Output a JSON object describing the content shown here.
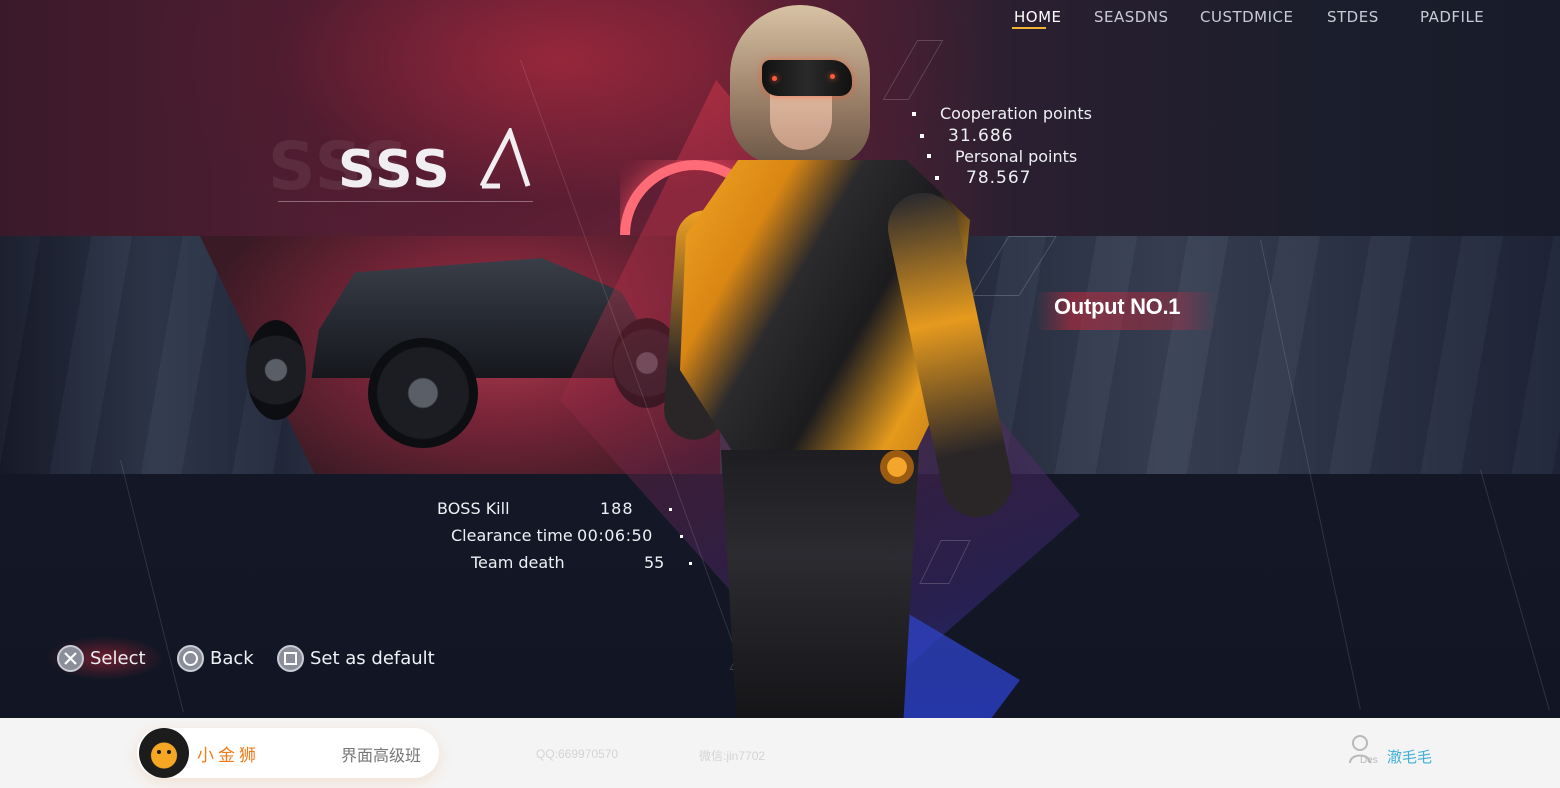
{
  "nav": {
    "items": [
      {
        "label": "HOME",
        "active": true
      },
      {
        "label": "SEASDNS",
        "active": false
      },
      {
        "label": "CUSTDMICE",
        "active": false
      },
      {
        "label": "STDES",
        "active": false
      },
      {
        "label": "PADFILE",
        "active": false
      }
    ],
    "accent_color": "#f2b233"
  },
  "rank": {
    "grade": "SSS",
    "grade_ghost": "SSS"
  },
  "points": {
    "cooperation_label": "Cooperation points",
    "cooperation_value": "31.686",
    "personal_label": "Personal points",
    "personal_value": "78.567"
  },
  "output": {
    "label": "Output NO.1",
    "color": "#c8283c"
  },
  "stats": {
    "boss_kill_label": "BOSS Kill",
    "boss_kill_value": "188",
    "clearance_label": "Clearance time",
    "clearance_value": "00:06:50",
    "team_death_label": "Team death",
    "team_death_value": "55"
  },
  "hints": {
    "select": {
      "icon": "cross-button-icon",
      "label": "Select"
    },
    "back": {
      "icon": "circle-button-icon",
      "label": "Back"
    },
    "default": {
      "icon": "square-button-icon",
      "label": "Set as default"
    }
  },
  "footer": {
    "brand_name": "小金狮",
    "course": "界面高级班",
    "qq": "QQ:669970570",
    "wechat": "微信:jin7702",
    "designer_tag": "Des",
    "designer_name": "澈毛毛",
    "brand_color": "#f07b1a",
    "designer_color": "#3fb0d8"
  }
}
